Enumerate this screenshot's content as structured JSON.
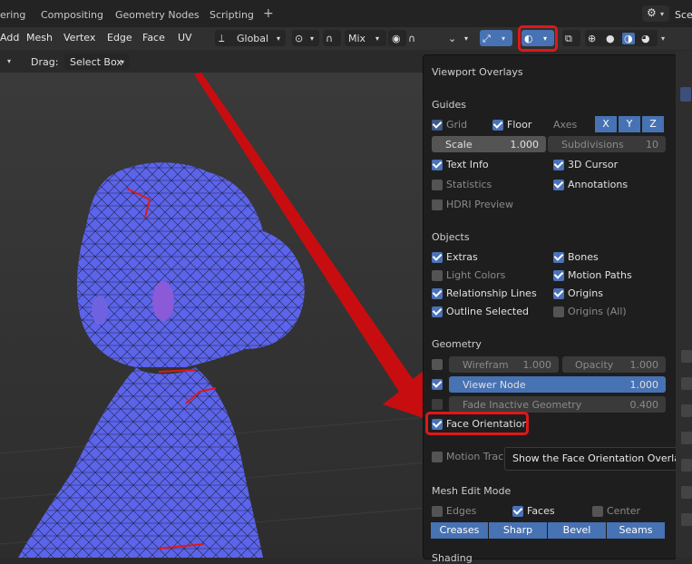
{
  "workspace_tabs": [
    "ering",
    "Compositing",
    "Geometry Nodes",
    "Scripting"
  ],
  "scene_label": "Sce",
  "header": {
    "menus": [
      "Add",
      "Mesh",
      "Vertex",
      "Edge",
      "Face",
      "UV"
    ],
    "orientation": "Global",
    "proportional_mode": "Mix"
  },
  "row2": {
    "drag_label": "Drag:",
    "drag_value": "Select Box"
  },
  "overlays": {
    "title": "Viewport Overlays",
    "guides": {
      "heading": "Guides",
      "grid": {
        "label": "Grid",
        "checked": true
      },
      "floor": {
        "label": "Floor",
        "checked": true
      },
      "axes_label": "Axes",
      "axes": [
        "X",
        "Y",
        "Z"
      ],
      "scale_label": "Scale",
      "scale_value": "1.000",
      "subdivisions_label": "Subdivisions",
      "subdivisions_value": "10",
      "text_info": {
        "label": "Text Info",
        "checked": true
      },
      "cursor_3d": {
        "label": "3D Cursor",
        "checked": true
      },
      "statistics": {
        "label": "Statistics",
        "checked": false
      },
      "annotations": {
        "label": "Annotations",
        "checked": true
      },
      "hdri_preview": {
        "label": "HDRI Preview",
        "checked": false
      }
    },
    "objects": {
      "heading": "Objects",
      "extras": {
        "label": "Extras",
        "checked": true
      },
      "bones": {
        "label": "Bones",
        "checked": true
      },
      "light_colors": {
        "label": "Light Colors",
        "checked": false
      },
      "motion_paths": {
        "label": "Motion Paths",
        "checked": true
      },
      "relationship_lines": {
        "label": "Relationship Lines",
        "checked": true
      },
      "origins": {
        "label": "Origins",
        "checked": true
      },
      "outline_selected": {
        "label": "Outline Selected",
        "checked": true
      },
      "origins_all": {
        "label": "Origins (All)",
        "checked": false
      }
    },
    "geometry": {
      "heading": "Geometry",
      "wireframe_label": "Wirefram",
      "wireframe_value": "1.000",
      "opacity_label": "Opacity",
      "opacity_value": "1.000",
      "viewer_node_label": "Viewer Node",
      "viewer_node_value": "1.000",
      "fade_label": "Fade Inactive Geometry",
      "fade_value": "0.400",
      "face_orientation": {
        "label": "Face Orientation",
        "checked": true
      },
      "motion_tracking_label": "Motion Tracki"
    },
    "mesh_edit_mode": {
      "heading": "Mesh Edit Mode",
      "edges": {
        "label": "Edges",
        "checked": false
      },
      "faces": {
        "label": "Faces",
        "checked": true
      },
      "center": {
        "label": "Center",
        "checked": false
      },
      "buttons": [
        "Creases",
        "Sharp",
        "Bevel",
        "Seams"
      ]
    },
    "shading_heading": "Shading"
  },
  "tooltip": "Show the Face Orientation Overlay.",
  "colors": {
    "accent": "#4772b3",
    "highlight_red": "#e0171a",
    "mesh_blue": "#5860e8"
  }
}
